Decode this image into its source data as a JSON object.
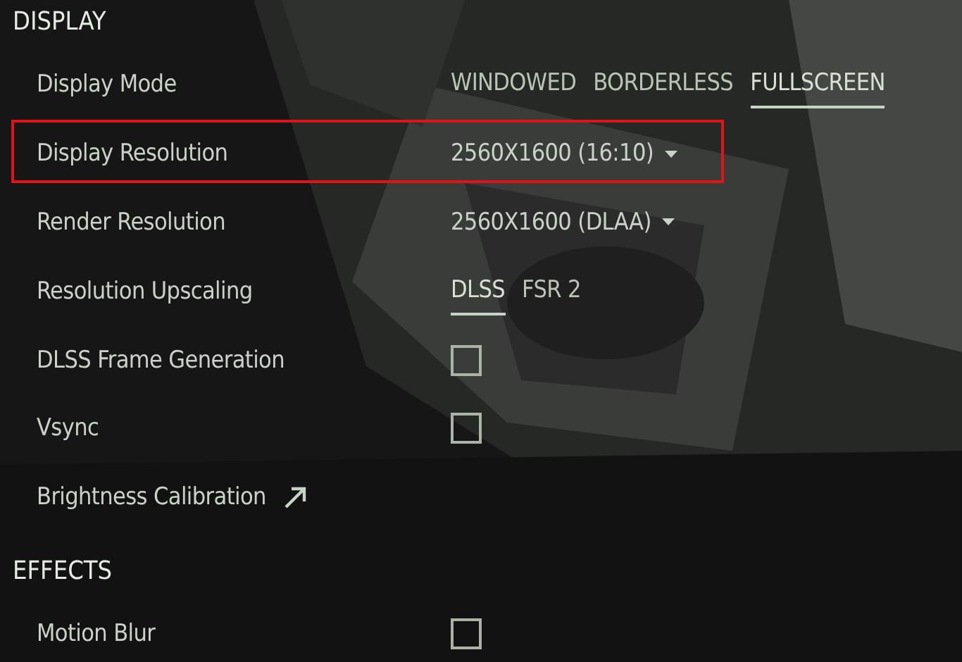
{
  "sections": [
    {
      "title": "DISPLAY",
      "settings": [
        {
          "kind": "options",
          "label": "Display Mode",
          "highlighted": false,
          "options": [
            {
              "label": "WINDOWED",
              "selected": false
            },
            {
              "label": "BORDERLESS",
              "selected": false
            },
            {
              "label": "FULLSCREEN",
              "selected": true
            }
          ]
        },
        {
          "kind": "dropdown",
          "label": "Display Resolution",
          "highlighted": true,
          "value": "2560X1600 (16:10)"
        },
        {
          "kind": "dropdown",
          "label": "Render Resolution",
          "highlighted": false,
          "value": "2560X1600 (DLAA)"
        },
        {
          "kind": "options",
          "label": "Resolution Upscaling",
          "highlighted": false,
          "options": [
            {
              "label": "DLSS",
              "selected": true
            },
            {
              "label": "FSR 2",
              "selected": false
            }
          ]
        },
        {
          "kind": "checkbox",
          "label": "DLSS Frame Generation",
          "highlighted": false,
          "checked": false
        },
        {
          "kind": "checkbox",
          "label": "Vsync",
          "highlighted": false,
          "checked": false
        },
        {
          "kind": "link",
          "label": "Brightness Calibration",
          "highlighted": false
        }
      ]
    },
    {
      "title": "EFFECTS",
      "settings": [
        {
          "kind": "checkbox",
          "label": "Motion Blur",
          "highlighted": false,
          "checked": false
        }
      ]
    }
  ]
}
